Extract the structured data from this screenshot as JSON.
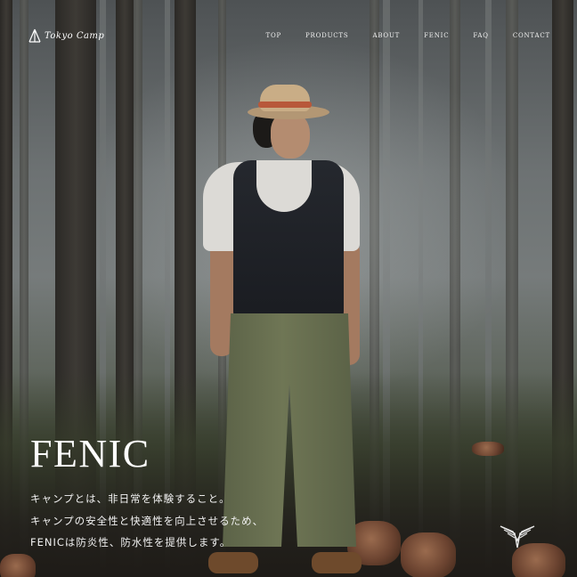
{
  "header": {
    "logo_text": "Tokyo Camp",
    "nav": [
      {
        "label": "TOP"
      },
      {
        "label": "PRODUCTS"
      },
      {
        "label": "ABOUT"
      },
      {
        "label": "FENIC"
      },
      {
        "label": "FAQ"
      },
      {
        "label": "CONTACT"
      }
    ]
  },
  "hero": {
    "title": "FENIC",
    "lines": [
      "キャンプとは、非日常を体験すること。",
      "キャンプの安全性と快適性を向上させるため、",
      "FENICは防炎性、防水性を提供します。"
    ]
  },
  "icons": {
    "logo": "tent-icon",
    "emblem": "wing-emblem-icon"
  },
  "colors": {
    "text": "#ffffff",
    "fog": "#767b7b",
    "trunk": "#2b2926"
  }
}
